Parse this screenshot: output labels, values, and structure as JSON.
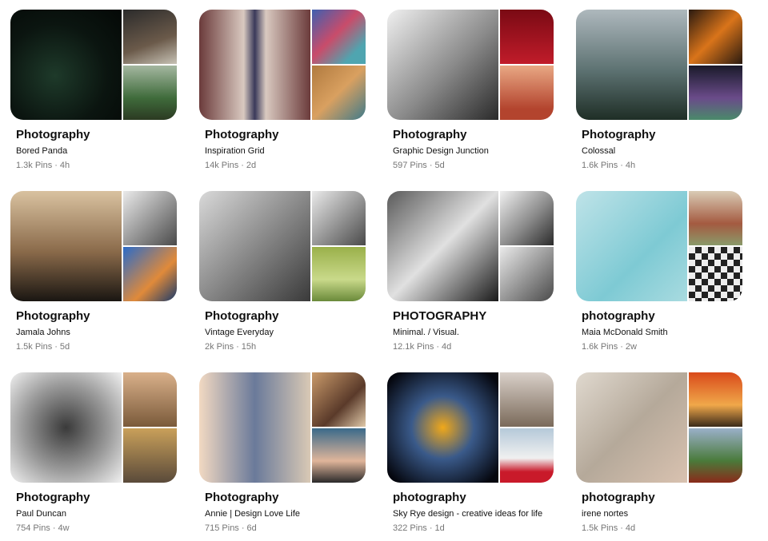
{
  "boards": [
    {
      "title": "Photography",
      "owner": "Bored Panda",
      "pins": "1.3k Pins",
      "age": "4h",
      "images": [
        "night-grass",
        "photographer-portrait",
        "forest-path"
      ]
    },
    {
      "title": "Photography",
      "owner": "Inspiration Grid",
      "pins": "14k Pins",
      "age": "2d",
      "images": [
        "building-lookup",
        "marble-swirl",
        "river-aerial"
      ]
    },
    {
      "title": "Photography",
      "owner": "Graphic Design Junction",
      "pins": "597 Pins",
      "age": "5d",
      "images": [
        "bw-martial-artist",
        "christmas-typography",
        "woman-portrait"
      ]
    },
    {
      "title": "Photography",
      "owner": "Colossal",
      "pins": "1.6k Pins",
      "age": "4h",
      "images": [
        "misty-landscape",
        "butterflies",
        "aurora-glass"
      ]
    },
    {
      "title": "Photography",
      "owner": "Jamala Johns",
      "pins": "1.5k Pins",
      "age": "5d",
      "images": [
        "horse-rider",
        "bw-street",
        "blue-sky-portrait"
      ]
    },
    {
      "title": "Photography",
      "owner": "Vintage Everyday",
      "pins": "2k Pins",
      "age": "15h",
      "images": [
        "vintage-mirror",
        "bw-model",
        "green-field-model"
      ]
    },
    {
      "title": "PHOTOGRAPHY",
      "owner": "Minimal. / Visual.",
      "pins": "12.1k Pins",
      "age": "4d",
      "images": [
        "bw-woman-portrait",
        "bw-face",
        "bw-figure"
      ]
    },
    {
      "title": "photography",
      "owner": "Maia McDonald Smith",
      "pins": "1.6k Pins",
      "age": "2w",
      "images": [
        "pool-float",
        "flower-still",
        "checkered-table"
      ]
    },
    {
      "title": "Photography",
      "owner": "Paul Duncan",
      "pins": "754 Pins",
      "age": "4w",
      "images": [
        "bw-bear",
        "tent-interior",
        "room-scene"
      ]
    },
    {
      "title": "Photography",
      "owner": "Annie | Design Love Life",
      "pins": "715 Pins",
      "age": "6d",
      "images": [
        "baby-bunny",
        "photo-collage",
        "eye-closeup"
      ]
    },
    {
      "title": "photography",
      "owner": "Sky Rye design - creative ideas for life",
      "pins": "322 Pins",
      "age": "1d",
      "images": [
        "city-lights",
        "couple-winter",
        "snow-sled"
      ]
    },
    {
      "title": "photography",
      "owner": "irene nortes",
      "pins": "1.5k Pins",
      "age": "4d",
      "images": [
        "tabletop-collage",
        "sunset-sea",
        "mountain-cabin"
      ]
    }
  ],
  "separator": "·"
}
